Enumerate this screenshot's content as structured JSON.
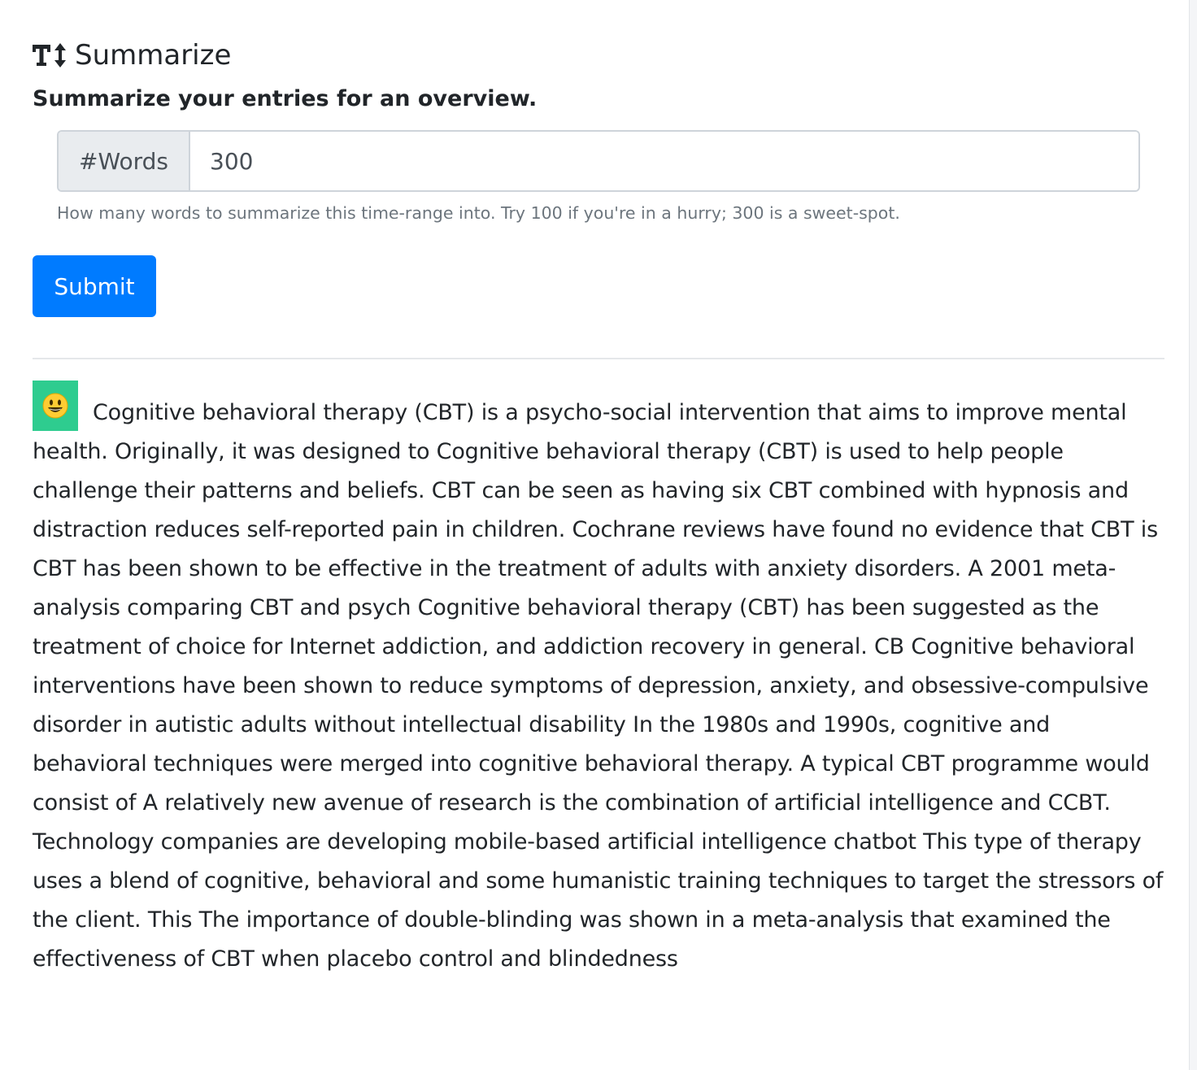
{
  "header": {
    "title": "Summarize",
    "subtitle": "Summarize your entries for an overview.",
    "icon": "text-height-icon"
  },
  "form": {
    "words_label": "#Words",
    "words_value": "300",
    "help_text": "How many words to summarize this time-range into. Try 100 if you're in a hurry; 300 is a sweet-spot.",
    "submit_label": "Submit"
  },
  "result": {
    "avatar_icon": "smiley-face-icon",
    "avatar_color": "#2ecc8f",
    "text": "Cognitive behavioral therapy (CBT) is a psycho-social intervention that aims to improve mental health. Originally, it was designed to Cognitive behavioral therapy (CBT) is used to help people challenge their patterns and beliefs. CBT can be seen as having six CBT combined with hypnosis and distraction reduces self-reported pain in children. Cochrane reviews have found no evidence that CBT is CBT has been shown to be effective in the treatment of adults with anxiety disorders. A 2001 meta-analysis comparing CBT and psych Cognitive behavioral therapy (CBT) has been suggested as the treatment of choice for Internet addiction, and addiction recovery in general. CB Cognitive behavioral interventions have been shown to reduce symptoms of depression, anxiety, and obsessive-compulsive disorder in autistic adults without intellectual disability In the 1980s and 1990s, cognitive and behavioral techniques were merged into cognitive behavioral therapy. A typical CBT programme would consist of A relatively new avenue of research is the combination of artificial intelligence and CCBT. Technology companies are developing mobile-based artificial intelligence chatbot This type of therapy uses a blend of cognitive, behavioral and some humanistic training techniques to target the stressors of the client. This The importance of double-blinding was shown in a meta-analysis that examined the effectiveness of CBT when placebo control and blindedness"
  },
  "colors": {
    "primary": "#007bff",
    "prepend_bg": "#e9ecef",
    "muted_text": "#6c757d"
  }
}
